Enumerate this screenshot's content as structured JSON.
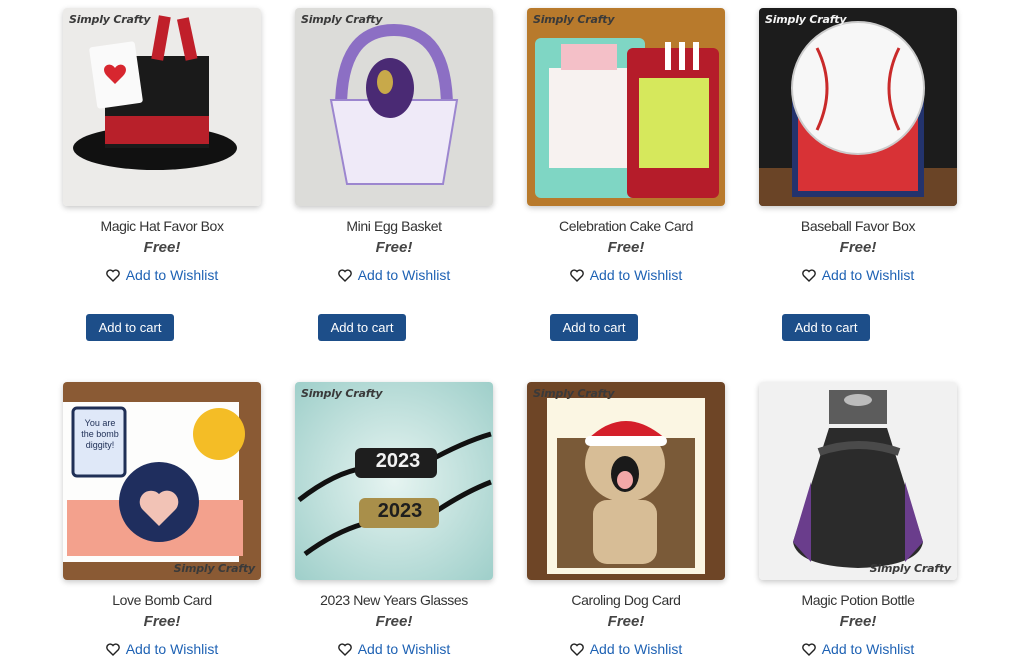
{
  "brand_text": "Simply Crafty",
  "products": [
    {
      "title": "Magic Hat Favor Box",
      "price": "Free!",
      "wishlist": "Add to Wishlist",
      "cart": "Add to cart"
    },
    {
      "title": "Mini Egg Basket",
      "price": "Free!",
      "wishlist": "Add to Wishlist",
      "cart": "Add to cart"
    },
    {
      "title": "Celebration Cake Card",
      "price": "Free!",
      "wishlist": "Add to Wishlist",
      "cart": "Add to cart"
    },
    {
      "title": "Baseball Favor Box",
      "price": "Free!",
      "wishlist": "Add to Wishlist",
      "cart": "Add to cart"
    },
    {
      "title": "Love Bomb Card",
      "price": "Free!",
      "wishlist": "Add to Wishlist",
      "card_text": "You are the bomb diggity!"
    },
    {
      "title": "2023 New Years Glasses",
      "price": "Free!",
      "wishlist": "Add to Wishlist",
      "glasses_text": "2023"
    },
    {
      "title": "Caroling Dog Card",
      "price": "Free!",
      "wishlist": "Add to Wishlist"
    },
    {
      "title": "Magic Potion Bottle",
      "price": "Free!",
      "wishlist": "Add to Wishlist"
    }
  ],
  "colors": {
    "link": "#1e62b4",
    "button": "#1d4e89",
    "text": "#333333"
  }
}
